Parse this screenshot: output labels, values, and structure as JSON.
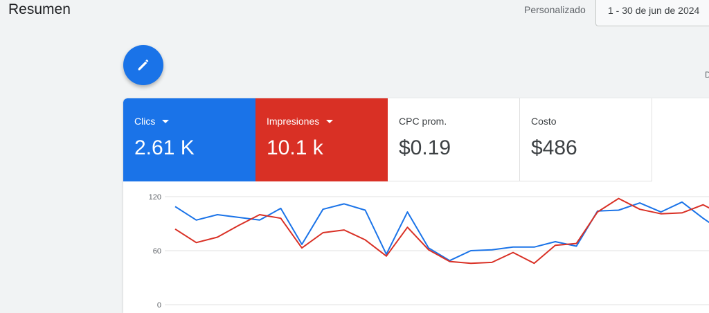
{
  "header": {
    "title": "Resumen",
    "date_mode": "Personalizado",
    "date_range": "1 - 30 de jun de 2024",
    "right_edge_text": "D"
  },
  "fab": {
    "icon": "pencil-icon"
  },
  "metrics": [
    {
      "label": "Clics",
      "value": "2.61 K",
      "color": "#1a73e8",
      "has_dropdown": true
    },
    {
      "label": "Impresiones",
      "value": "10.1 k",
      "color": "#d93025",
      "has_dropdown": true
    },
    {
      "label": "CPC prom.",
      "value": "$0.19",
      "has_dropdown": false
    },
    {
      "label": "Costo",
      "value": "$486",
      "has_dropdown": false
    }
  ],
  "chart_data": {
    "type": "line",
    "y_ticks": [
      "120",
      "60",
      "0"
    ],
    "ylim": [
      0,
      120
    ],
    "grid": true,
    "x": [
      1,
      2,
      3,
      4,
      5,
      6,
      7,
      8,
      9,
      10,
      11,
      12,
      13,
      14,
      15,
      16,
      17,
      18,
      19,
      20,
      21,
      22,
      23,
      24,
      25,
      26,
      27,
      28,
      29,
      30
    ],
    "series": [
      {
        "color": "#1a73e8",
        "values": [
          109,
          94,
          100,
          97,
          94,
          107,
          67,
          106,
          112,
          105,
          56,
          103,
          63,
          49,
          60,
          61,
          64,
          64,
          70,
          65,
          104,
          105,
          113,
          103,
          114,
          96,
          80,
          85,
          88,
          90
        ]
      },
      {
        "color": "#d93025",
        "values": [
          84,
          69,
          75,
          88,
          100,
          96,
          63,
          80,
          83,
          72,
          54,
          86,
          61,
          48,
          46,
          47,
          58,
          46,
          66,
          68,
          103,
          118,
          106,
          101,
          102,
          111,
          99,
          95,
          97,
          98
        ]
      }
    ]
  }
}
